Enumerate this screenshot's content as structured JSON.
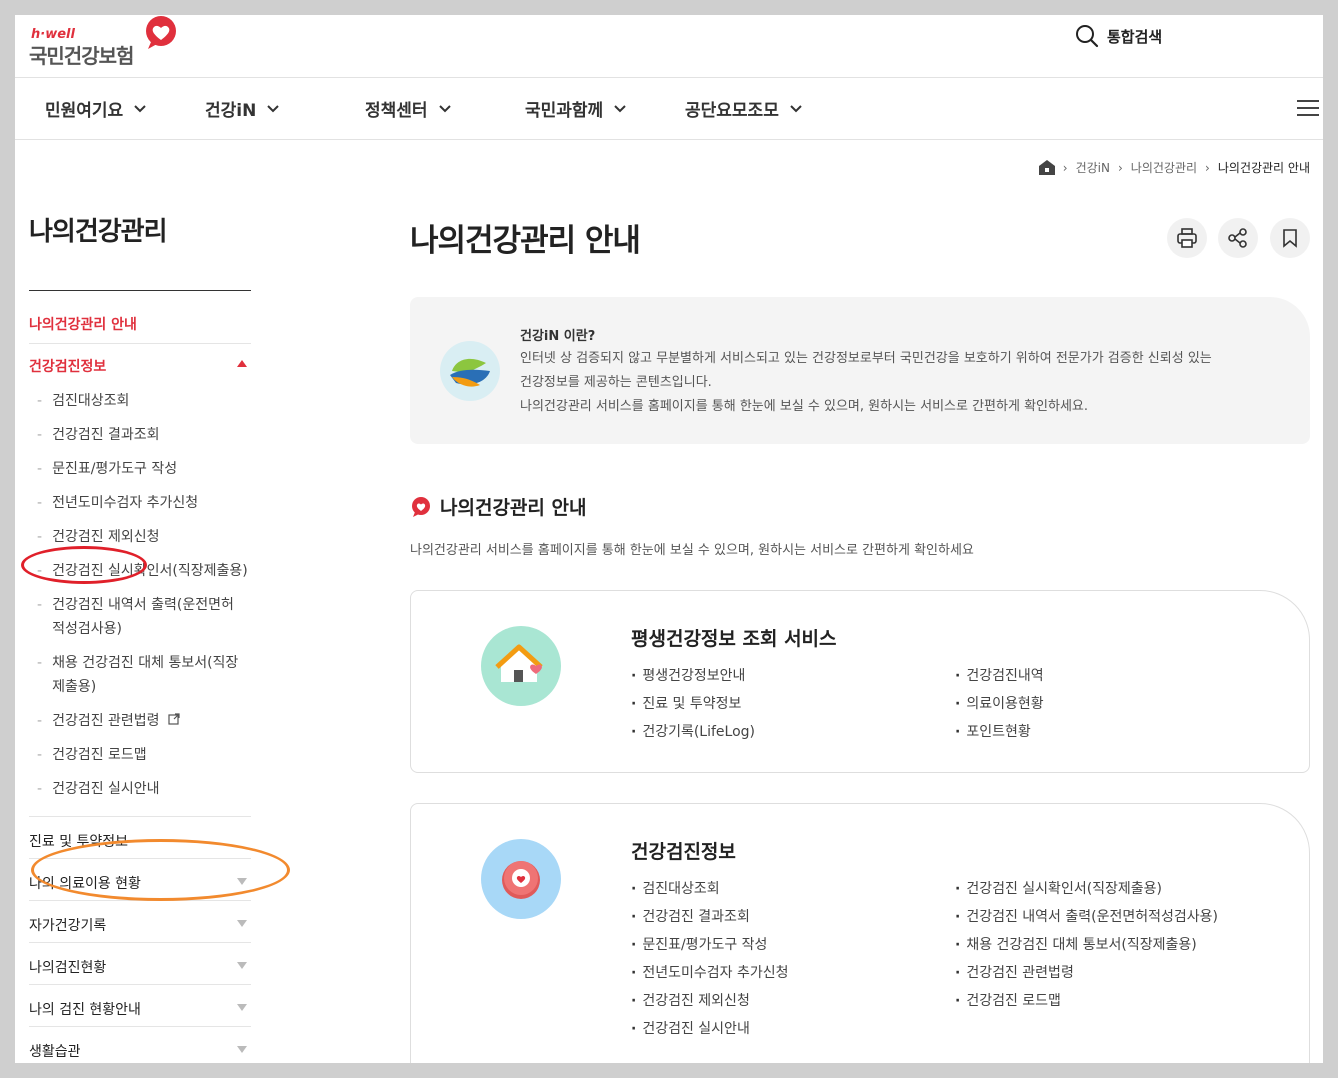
{
  "header": {
    "logo_en": "h·well",
    "logo_kr": "국민건강보험",
    "search_label": "통합검색"
  },
  "gnb": [
    {
      "label": "민원여기요"
    },
    {
      "label": "건강iN"
    },
    {
      "label": "정책센터"
    },
    {
      "label": "국민과함께"
    },
    {
      "label": "공단요모조모"
    }
  ],
  "breadcrumb": [
    "건강iN",
    "나의건강관리",
    "나의건강관리 안내"
  ],
  "lnb": {
    "title": "나의건강관리",
    "items": [
      {
        "label": "나의건강관리 안내"
      },
      {
        "label": "건강검진정보"
      },
      {
        "label": "진료 및 투약정보"
      },
      {
        "label": "나의 의료이용 현황"
      },
      {
        "label": "자가건강기록"
      },
      {
        "label": "나의검진현황"
      },
      {
        "label": "나의 검진 현황안내"
      },
      {
        "label": "생활습관"
      }
    ],
    "sub_items": [
      {
        "label": "검진대상조회"
      },
      {
        "label": "건강검진 결과조회"
      },
      {
        "label": "문진표/평가도구 작성"
      },
      {
        "label": "전년도미수검자 추가신청"
      },
      {
        "label": "건강검진 제외신청"
      },
      {
        "label": "건강검진 실시확인서(직장제출용)"
      },
      {
        "label": "건강검진 내역서 출력(운전면허적성검사용)"
      },
      {
        "label": "채용 건강검진 대체 통보서(직장제출용)"
      },
      {
        "label": "건강검진 관련법령"
      },
      {
        "label": "건강검진 로드맵"
      },
      {
        "label": "건강검진 실시안내"
      }
    ]
  },
  "main": {
    "title": "나의건강관리 안내",
    "intro": {
      "question": "건강iN 이란?",
      "line1": "인터넷 상 검증되지 않고 무분별하게 서비스되고 있는 건강정보로부터 국민건강을 보호하기 위하여 전문가가 검증한 신뢰성 있는",
      "line2": "건강정보를 제공하는 콘텐츠입니다.",
      "line3": "나의건강관리 서비스를 홈페이지를 통해 한눈에 보실 수 있으며, 원하시는 서비스로 간편하게 확인하세요."
    },
    "section_title": "나의건강관리 안내",
    "section_desc": "나의건강관리 서비스를 홈페이지를 통해 한눈에 보실 수 있으며, 원하시는 서비스로 간편하게 확인하세요",
    "cards": [
      {
        "title": "평생건강정보 조회 서비스",
        "left": [
          "평생건강정보안내",
          "진료 및 투약정보",
          "건강기록(LifeLog)"
        ],
        "right": [
          "건강검진내역",
          "의료이용현황",
          "포인트현황"
        ]
      },
      {
        "title": "건강검진정보",
        "left": [
          "검진대상조회",
          "건강검진 결과조회",
          "문진표/평가도구 작성",
          "전년도미수검자 추가신청",
          "건강검진 제외신청",
          "건강검진 실시안내"
        ],
        "right": [
          "건강검진 실시확인서(직장제출용)",
          "건강검진 내역서 출력(운전면허적성검사용)",
          "채용 건강검진 대체 통보서(직장제출용)",
          "건강검진 관련법령",
          "건강검진 로드맵"
        ]
      }
    ]
  },
  "colors": {
    "brand_red": "#e0303d",
    "annotation_red": "#e0202a",
    "annotation_orange": "#f28a2e"
  }
}
